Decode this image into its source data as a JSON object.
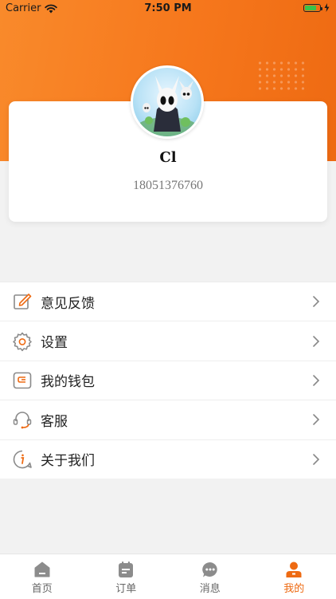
{
  "status_bar": {
    "carrier": "Carrier",
    "time": "7:50 PM",
    "battery_level": 0.8
  },
  "profile": {
    "name": "Cl",
    "phone": "18051376760"
  },
  "menu": [
    {
      "label": "意见反馈",
      "icon": "edit-icon"
    },
    {
      "label": "设置",
      "icon": "gear-icon"
    },
    {
      "label": "我的钱包",
      "icon": "wallet-icon"
    },
    {
      "label": "客服",
      "icon": "headset-icon"
    },
    {
      "label": "关于我们",
      "icon": "info-icon"
    }
  ],
  "tabs": [
    {
      "label": "首页",
      "icon": "home-icon",
      "active": false
    },
    {
      "label": "订单",
      "icon": "orders-icon",
      "active": false
    },
    {
      "label": "消息",
      "icon": "message-icon",
      "active": false
    },
    {
      "label": "我的",
      "icon": "profile-icon",
      "active": true
    }
  ],
  "colors": {
    "accent": "#ee6a12",
    "hero_start": "#f98a2b",
    "hero_end": "#ee6a12",
    "menu_icon": "#8a8a8a",
    "tab_inactive": "#8c8c8c"
  }
}
